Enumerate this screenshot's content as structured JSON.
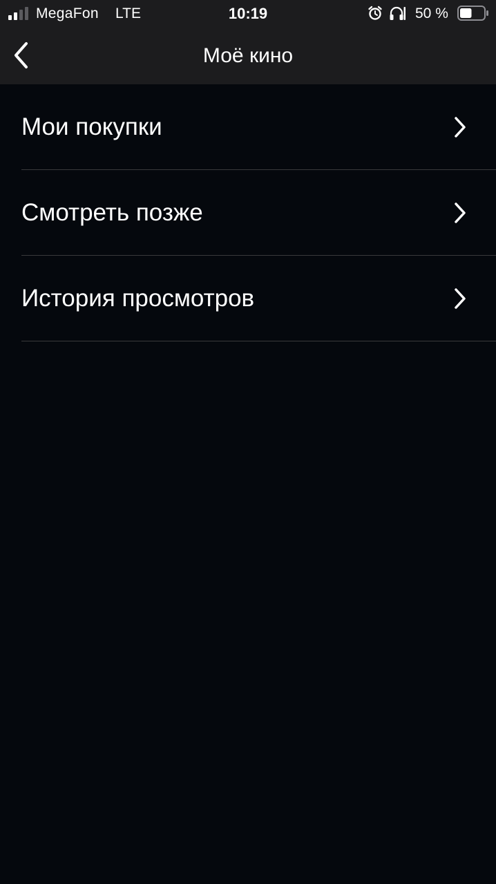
{
  "status_bar": {
    "carrier": "MegaFon",
    "network": "LTE",
    "time": "10:19",
    "battery_percent": "50 %",
    "signal_bars": 2,
    "battery_level": 0.5,
    "icons": [
      "signal-icon",
      "alarm-icon",
      "headphones-icon",
      "battery-icon"
    ]
  },
  "header": {
    "title": "Моё кино",
    "back_icon": "chevron-left-icon"
  },
  "menu": {
    "items": [
      {
        "label": "Мои покупки",
        "icon": "chevron-right-icon"
      },
      {
        "label": "Смотреть позже",
        "icon": "chevron-right-icon"
      },
      {
        "label": "История просмотров",
        "icon": "chevron-right-icon"
      }
    ]
  },
  "colors": {
    "background": "#05080d",
    "header_background": "#1c1c1e",
    "separator": "#3a3a3c",
    "text": "#ffffff"
  }
}
